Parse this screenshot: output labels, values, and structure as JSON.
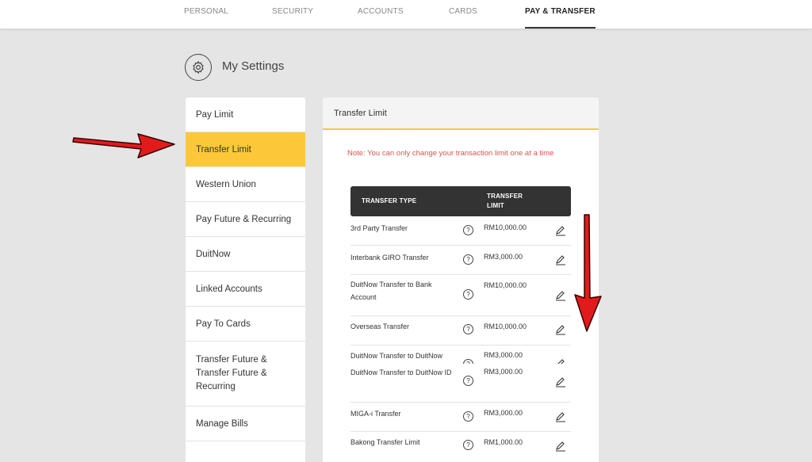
{
  "nav": {
    "tabs": [
      {
        "label": "PERSONAL"
      },
      {
        "label": "SECURITY"
      },
      {
        "label": "ACCOUNTS"
      },
      {
        "label": "CARDS"
      },
      {
        "label": "PAY & TRANSFER",
        "active": true
      }
    ]
  },
  "settings": {
    "title": "My Settings",
    "icon": "gear-icon"
  },
  "sidebar": {
    "items": [
      {
        "label": "Pay Limit"
      },
      {
        "label": "Transfer Limit",
        "active": true
      },
      {
        "label": "Western Union"
      },
      {
        "label": "Pay Future & Recurring"
      },
      {
        "label": "DuitNow"
      },
      {
        "label": "Linked Accounts"
      },
      {
        "label": "Pay To Cards"
      },
      {
        "label": "Transfer Future & Transfer Future & Recurring"
      },
      {
        "label": "Manage Bills"
      }
    ]
  },
  "panel": {
    "title": "Transfer Limit",
    "note": "Note: You can only change your transaction limit one at a time",
    "table": {
      "headers": [
        "TRANSFER TYPE",
        "TRANSFER LIMIT"
      ],
      "rows": [
        {
          "type": "3rd Party Transfer",
          "limit": "RM10,000.00"
        },
        {
          "type": "Interbank GIRO Transfer",
          "limit": "RM3,000.00"
        },
        {
          "type": "DuitNow Transfer to Bank Account",
          "limit": "RM10,000.00"
        },
        {
          "type": "Overseas Transfer",
          "limit": "RM10,000.00"
        },
        {
          "type": "DuitNow Transfer to DuitNow",
          "limit": "RM3,000.00"
        },
        {
          "type": "DuitNow Transfer to DuitNow ID",
          "limit": "RM3,000.00"
        },
        {
          "type": "MIGA-i Transfer",
          "limit": "RM3,000.00"
        },
        {
          "type": "Bakong Transfer Limit",
          "limit": "RM1,000.00"
        }
      ]
    }
  },
  "colors": {
    "accent": "#fcc83a",
    "header_dark": "#333333",
    "note_red": "#d9534f",
    "arrow_red": "#e11b1b"
  },
  "icons": {
    "help": "question-icon",
    "edit": "pencil-icon"
  }
}
